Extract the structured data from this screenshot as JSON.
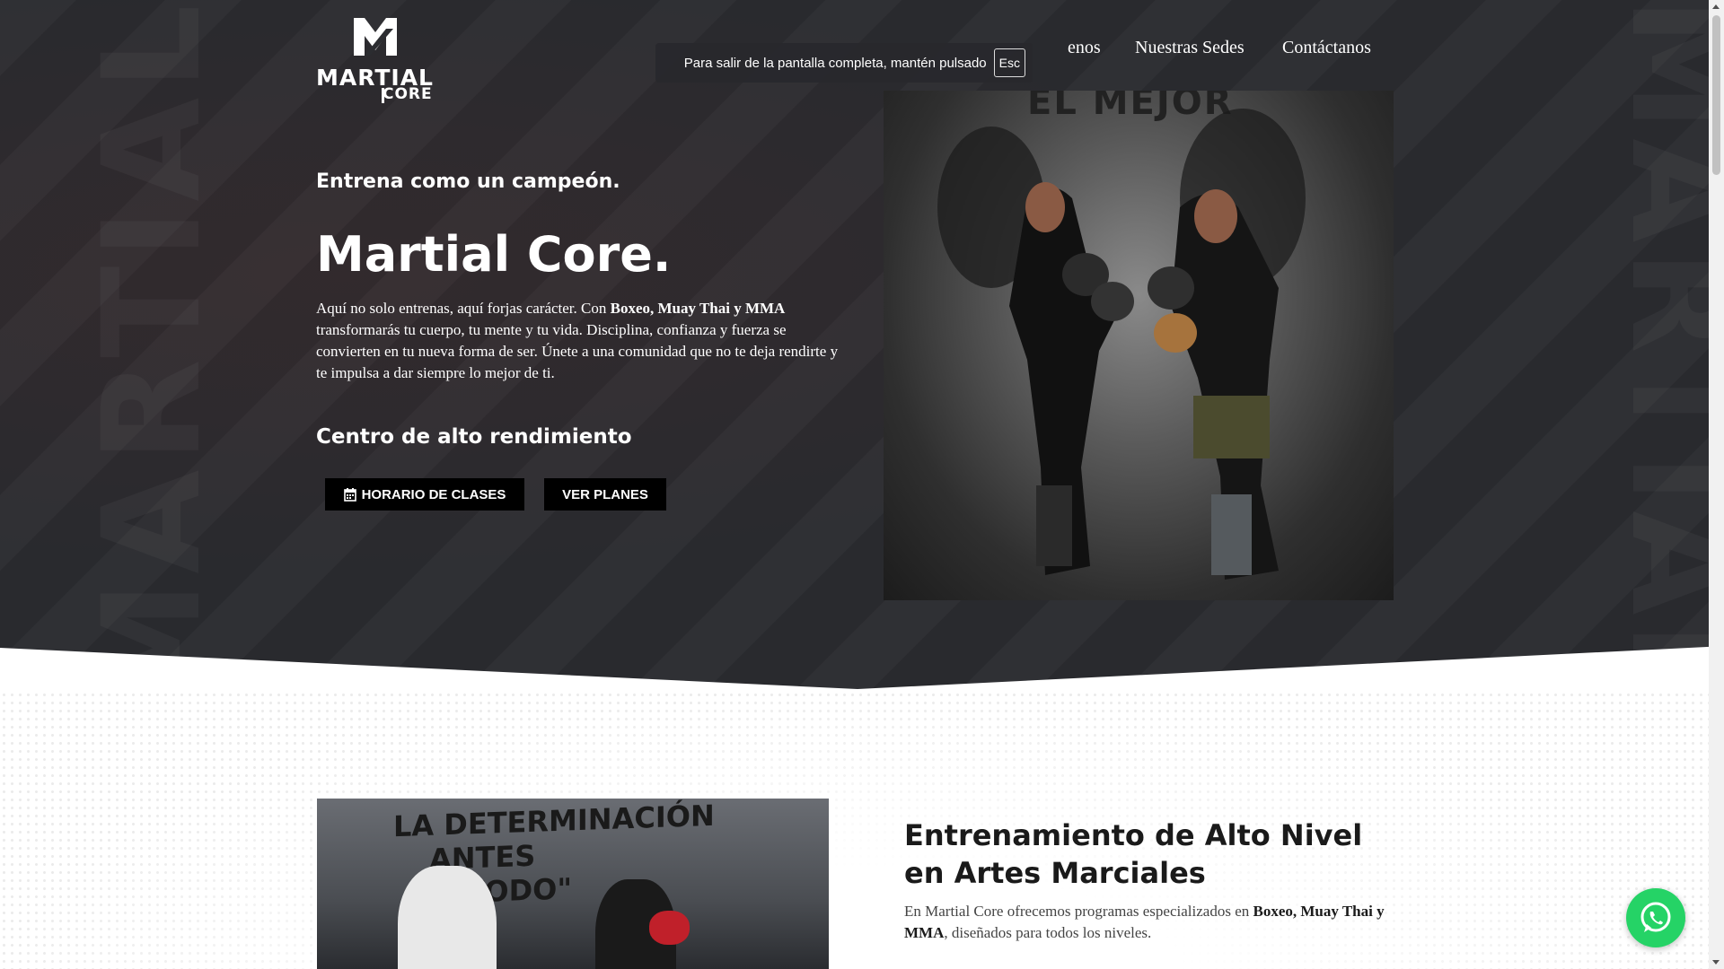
{
  "logo": {
    "line1": "MARTIAL",
    "line2": "CORE"
  },
  "fullscreen_notice": {
    "text": "Para salir de la pantalla completa, mantén pulsado",
    "key": "Esc"
  },
  "nav": {
    "items": [
      "enos",
      "Nuestras Sedes",
      "Contáctanos"
    ]
  },
  "hero": {
    "subtitle": "Entrena como un campeón.",
    "title": "Martial Core.",
    "intro_before": "Aquí no solo entrenas, aquí forjas carácter. Con ",
    "intro_bold": "Boxeo, Muay Thai y MMA",
    "intro_after": " transformarás tu cuerpo, tu mente y tu vida. Disciplina, confianza y fuerza se convierten en tu nueva forma de ser. Únete a una comunidad que no te deja rendirte y te impulsa a dar siempre lo mejor de ti.",
    "section_label": "Centro de alto rendimiento",
    "button_schedule": "HORARIO DE CLASES",
    "button_plans": "VER PLANES",
    "photo_banner": "EL MEJOR",
    "watermark": "MARTIAL"
  },
  "training": {
    "photo_banner_line1": "LA DETERMINACIÓN",
    "photo_banner_line2": "ANTES",
    "photo_banner_line3": "DE TODO\"",
    "title": "Entrenamiento de Alto Nivel en Artes Marciales",
    "text_before": "En Martial Core ofrecemos programas especializados en ",
    "text_bold": "Boxeo, Muay Thai y MMA",
    "text_after": ", diseñados para todos los niveles."
  },
  "icons": {
    "calendar": "calendar-icon",
    "whatsapp": "whatsapp-icon",
    "brand": "martial-core-logo-mark"
  },
  "colors": {
    "hero_background": "#2b2c30",
    "button_background": "#000000",
    "whatsapp_green": "#25d366"
  }
}
